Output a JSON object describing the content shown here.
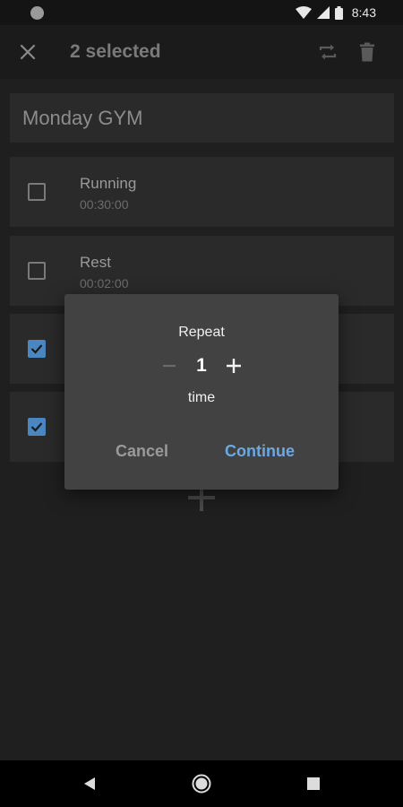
{
  "status_bar": {
    "time": "8:43"
  },
  "toolbar": {
    "title": "2 selected"
  },
  "workout": {
    "name": "Monday GYM"
  },
  "items": [
    {
      "label": "Running",
      "duration": "00:30:00",
      "checked": false
    },
    {
      "label": "Rest",
      "duration": "00:02:00",
      "checked": false
    },
    {
      "label": "",
      "duration": "",
      "checked": true
    },
    {
      "label": "",
      "duration": "",
      "checked": true
    }
  ],
  "dialog": {
    "title": "Repeat",
    "value": "1",
    "unit": "time",
    "cancel_label": "Cancel",
    "continue_label": "Continue"
  },
  "colors": {
    "accent": "#6aa9e6",
    "checkbox_checked": "#4a86c0",
    "background": "#1f1f1f",
    "card": "#2a2a2a",
    "dialog": "#424242"
  }
}
